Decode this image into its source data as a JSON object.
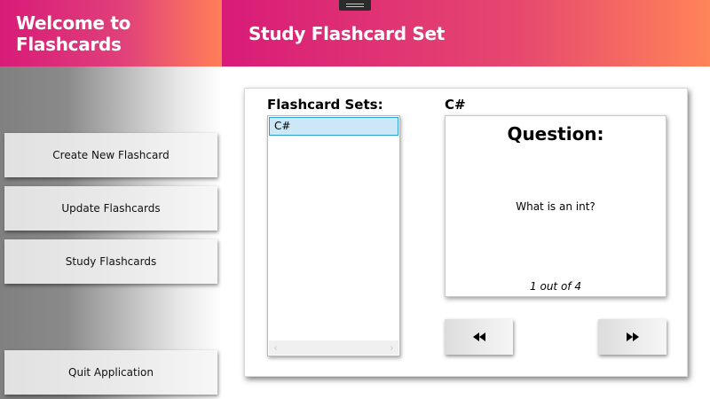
{
  "header": {
    "left_title": "Welcome to Flashcards",
    "right_title": "Study Flashcard Set"
  },
  "sidebar": {
    "create_label": "Create New Flashcard",
    "update_label": "Update Flashcards",
    "study_label": "Study Flashcards",
    "quit_label": "Quit Application"
  },
  "main": {
    "sets_label": "Flashcard Sets:",
    "sets": [
      "C#"
    ],
    "selected_set": "C#",
    "question_heading": "Question:",
    "question_text": "What is an int?",
    "counter": "1 out of 4"
  },
  "icons": {
    "previous": "rewind-icon",
    "next": "fast-forward-icon",
    "scroll_left": "chevron-left-icon",
    "scroll_right": "chevron-right-icon"
  },
  "colors": {
    "header_start": "#d81b78",
    "header_end": "#ff7f57",
    "selection": "#cce8f6",
    "selection_border": "#2e9fd2"
  }
}
